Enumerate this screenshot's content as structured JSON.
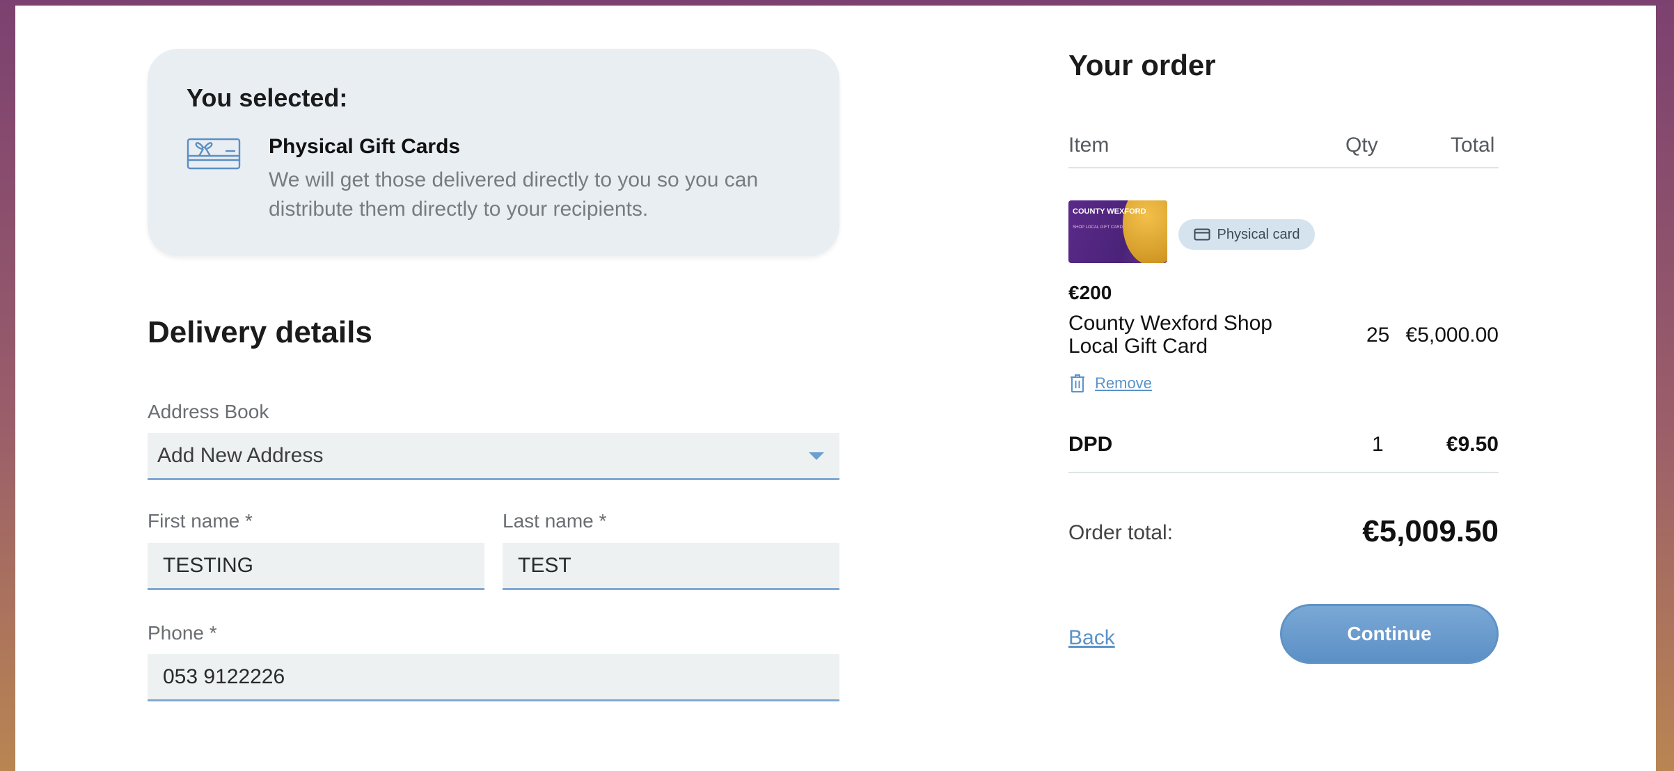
{
  "selection": {
    "title": "You selected:",
    "product_name": "Physical Gift Cards",
    "product_desc": "We will get those delivered directly to you so you can distribute them directly to your recipients.",
    "icon": "gift-card-icon"
  },
  "delivery": {
    "title": "Delivery details",
    "address_book_label": "Address Book",
    "address_book_value": "Add New Address",
    "first_name_label": "First name *",
    "first_name_value": "TESTING",
    "last_name_label": "Last name *",
    "last_name_value": "TEST",
    "phone_label": "Phone *",
    "phone_value": "053 9122226"
  },
  "order": {
    "title": "Your order",
    "headers": {
      "item": "Item",
      "qty": "Qty",
      "total": "Total"
    },
    "items": [
      {
        "thumb_text_1": "COUNTY WEXFORD",
        "thumb_text_2": "SHOP LOCAL GIFT CARD",
        "badge": "Physical card",
        "price": "€200",
        "name": "County Wexford Shop Local Gift Card",
        "qty": "25",
        "total": "€5,000.00",
        "remove_label": "Remove"
      }
    ],
    "shipping": {
      "name": "DPD",
      "qty": "1",
      "total": "€9.50"
    },
    "order_total_label": "Order total:",
    "order_total_value": "€5,009.50",
    "back_label": "Back",
    "continue_label": "Continue"
  },
  "colors": {
    "accent": "#5c90c5",
    "link": "#5a93c9",
    "field_bg": "#edf1f2",
    "panel_bg": "#e9eef3"
  }
}
